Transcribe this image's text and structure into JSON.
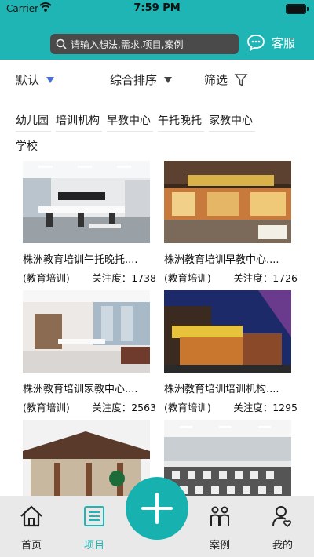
{
  "status": {
    "carrier": "Carrier",
    "time": "7:59 PM"
  },
  "header": {
    "search_placeholder": "请输入想法,需求,项目,案例",
    "service_label": "客服"
  },
  "filters": {
    "default_label": "默认",
    "sort_label": "综合排序",
    "filter_label": "筛选"
  },
  "tags": [
    "幼儿园",
    "培训机构",
    "早教中心",
    "午托晚托",
    "家教中心",
    "学校"
  ],
  "projects": [
    {
      "title": "株洲教育培训午托晚托....",
      "category": "(教育培训)",
      "attention": "关注度：1738"
    },
    {
      "title": "株洲教育培训早教中心....",
      "category": "(教育培训)",
      "attention": "关注度：1726"
    },
    {
      "title": "株洲教育培训家教中心....",
      "category": "(教育培训)",
      "attention": "关注度：2563"
    },
    {
      "title": "株洲教育培训培训机构....",
      "category": "(教育培训)",
      "attention": "关注度：1295"
    },
    {
      "title": "",
      "category": "",
      "attention": ""
    },
    {
      "title": "",
      "category": "",
      "attention": ""
    }
  ],
  "tabbar": {
    "home": "首页",
    "projects": "项目",
    "cases": "案例",
    "mine": "我的"
  },
  "colors": {
    "accent": "#1fb5b4",
    "tab_active": "#1fb5b4"
  }
}
